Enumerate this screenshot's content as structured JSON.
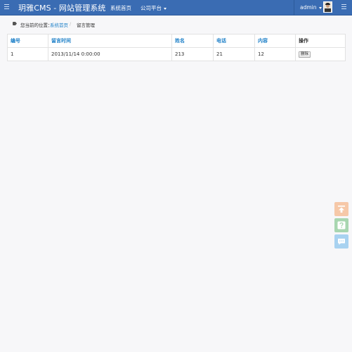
{
  "header": {
    "brand": "玥雅CMS - 网站管理系统",
    "nav": [
      {
        "label": "系统首页"
      },
      {
        "label": "公司平台"
      }
    ],
    "user": {
      "name": "admin"
    },
    "icons": {
      "left_toggle": "menu-icon",
      "right_toggle": "menu-icon",
      "avatar": "avatar-image"
    },
    "colors": {
      "bar": "#3a6cb3"
    }
  },
  "breadcrumb": {
    "prefix": "您当前的位置：",
    "home": "系统首页",
    "separator": "/",
    "current": "留言管理",
    "icon": "tag-icon"
  },
  "table": {
    "columns": [
      "编号",
      "留言时间",
      "姓名",
      "电话",
      "内容",
      "操作"
    ],
    "rows": [
      {
        "id": "1",
        "time": "2013/11/14 0:00:00",
        "name": "213",
        "phone": "21",
        "content": "12",
        "action": "删除"
      }
    ]
  },
  "float_buttons": [
    {
      "name": "back-to-top",
      "icon": "arrow-up-to-line-icon",
      "color": "#f6c8a8"
    },
    {
      "name": "help",
      "icon": "question-icon",
      "color": "#a8d6b0"
    },
    {
      "name": "feedback",
      "icon": "chat-icon",
      "color": "#a8d2f0"
    }
  ]
}
